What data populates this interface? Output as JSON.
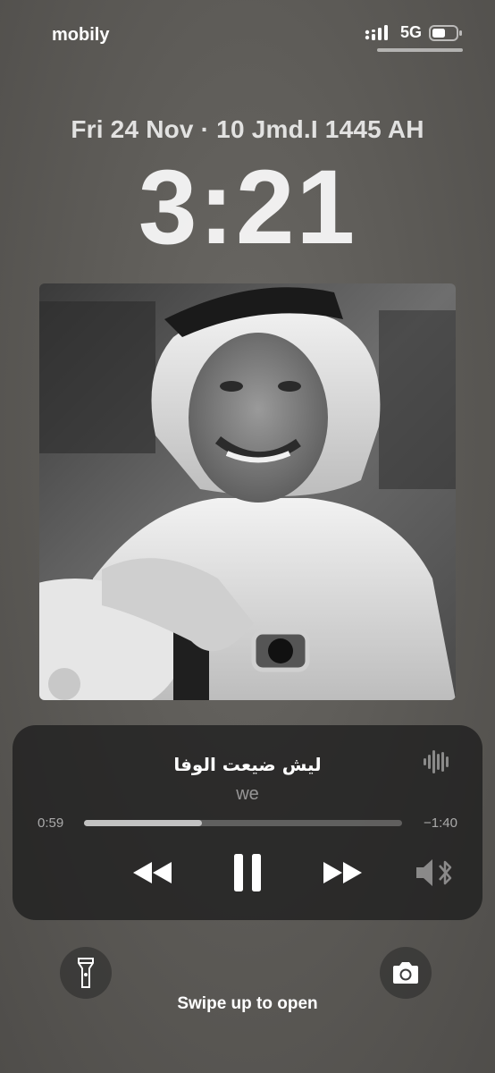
{
  "status_bar": {
    "carrier": "mobily",
    "network": "5G",
    "icons": [
      "signal-icon",
      "battery-icon"
    ]
  },
  "lock_screen": {
    "date": "Fri 24 Nov · 10 Jmd.I 1445 AH",
    "time": "3:21",
    "swipe_hint": "Swipe up to open"
  },
  "now_playing": {
    "title": "ليش ضيعت الوفا",
    "artist": "we",
    "elapsed": "0:59",
    "remaining": "−1:40",
    "progress": 0.37,
    "controls": [
      "rewind-icon",
      "pause-icon",
      "fast-forward-icon",
      "speaker-bluetooth-icon"
    ]
  },
  "quick_actions": [
    "flashlight-icon",
    "camera-icon"
  ]
}
